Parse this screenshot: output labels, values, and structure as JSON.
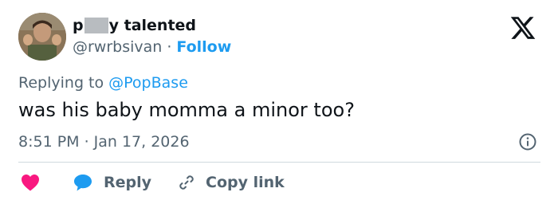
{
  "user": {
    "name_start": "p",
    "name_end": "y talented",
    "handle": "@rwrbsivan",
    "separator": "·",
    "follow_label": "Follow"
  },
  "tweet": {
    "replying_prefix": "Replying to ",
    "replying_to": "@PopBase",
    "text": "was his baby momma a minor too?",
    "time": "8:51 PM",
    "separator": "·",
    "date": "Jan 17, 2026"
  },
  "actions": {
    "reply_label": "Reply",
    "copy_link_label": "Copy link"
  },
  "icons": {
    "logo": "x-logo-icon",
    "info": "info-icon",
    "like": "heart-icon",
    "reply": "speech-bubble-icon",
    "copy": "link-icon"
  },
  "colors": {
    "accent": "#1d9bf0",
    "like": "#f91880",
    "text_primary": "#0f1419",
    "text_secondary": "#536471",
    "divider": "#cfd9de"
  }
}
